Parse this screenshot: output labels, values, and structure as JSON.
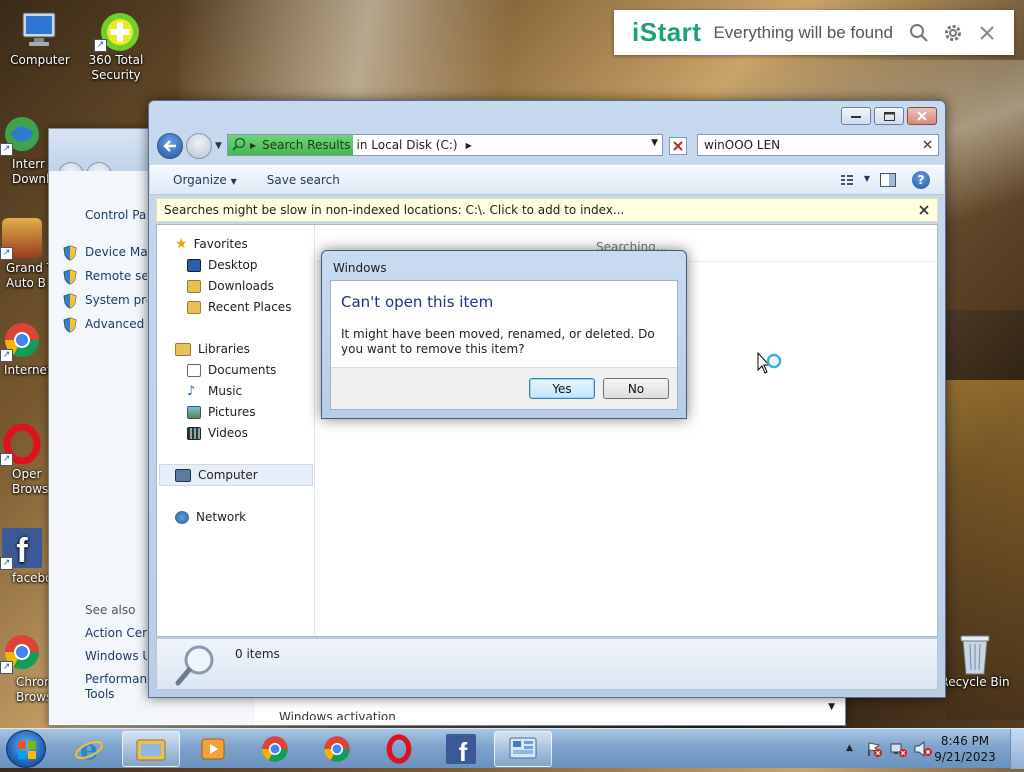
{
  "desktop": {
    "icons": [
      {
        "label": "Computer"
      },
      {
        "label": "360 Total Security"
      },
      {
        "label": "Interr Downl"
      },
      {
        "label": "Grand T Auto B"
      },
      {
        "label": "Internet"
      },
      {
        "label": "Oper Brows"
      },
      {
        "label": "facebo"
      },
      {
        "label": "Chrom Brows"
      },
      {
        "label": "Recycle Bin"
      }
    ]
  },
  "istart": {
    "logo": "iStart",
    "tagline": "Everything will be found"
  },
  "back_window": {
    "sidebar": {
      "home": "Control Pan",
      "links": [
        "Device Man",
        "Remote sett",
        "System prot",
        "Advanced sy"
      ],
      "see_also_label": "See also",
      "see_also": [
        "Action Cent",
        "Windows Up",
        "Performanc",
        "Tools"
      ]
    },
    "bottom_text": "Windows activation"
  },
  "explorer": {
    "address": {
      "highlight": "Search Results",
      "rest": "in Local Disk (C:)"
    },
    "search": {
      "value": "winOOO LEN"
    },
    "toolbar": {
      "organize": "Organize",
      "save_search": "Save search"
    },
    "infobar": "Searches might be slow in non-indexed locations: C:\\. Click to add to index...",
    "nav": {
      "favorites": "Favorites",
      "desktop": "Desktop",
      "downloads": "Downloads",
      "recent": "Recent Places",
      "libraries": "Libraries",
      "documents": "Documents",
      "music": "Music",
      "pictures": "Pictures",
      "videos": "Videos",
      "computer": "Computer",
      "network": "Network"
    },
    "searching": "Searching...",
    "status": "0 items"
  },
  "dialog": {
    "title": "Windows",
    "heading": "Can't open this item",
    "message": "It might have been moved, renamed, or deleted. Do you want to remove this item?",
    "yes": "Yes",
    "no": "No"
  },
  "taskbar": {
    "time": "8:46 PM",
    "date": "9/21/2023"
  },
  "colors": {
    "istart_green": "#1aa37a",
    "dialog_heading": "#1e3287",
    "address_highlight": "#45b852"
  }
}
